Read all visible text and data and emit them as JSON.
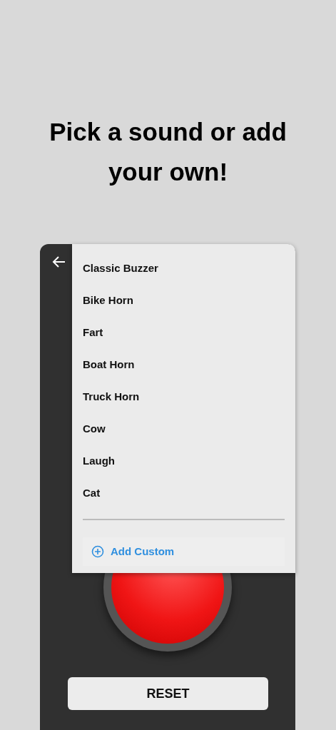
{
  "headline": "Pick a sound or add your own!",
  "sound_menu": {
    "items": [
      {
        "label": "Classic Buzzer"
      },
      {
        "label": "Bike Horn"
      },
      {
        "label": "Fart"
      },
      {
        "label": "Boat Horn"
      },
      {
        "label": "Truck Horn"
      },
      {
        "label": "Cow"
      },
      {
        "label": "Laugh"
      },
      {
        "label": "Cat"
      }
    ],
    "add_custom": "Add Custom"
  },
  "reset_button": "RESET"
}
